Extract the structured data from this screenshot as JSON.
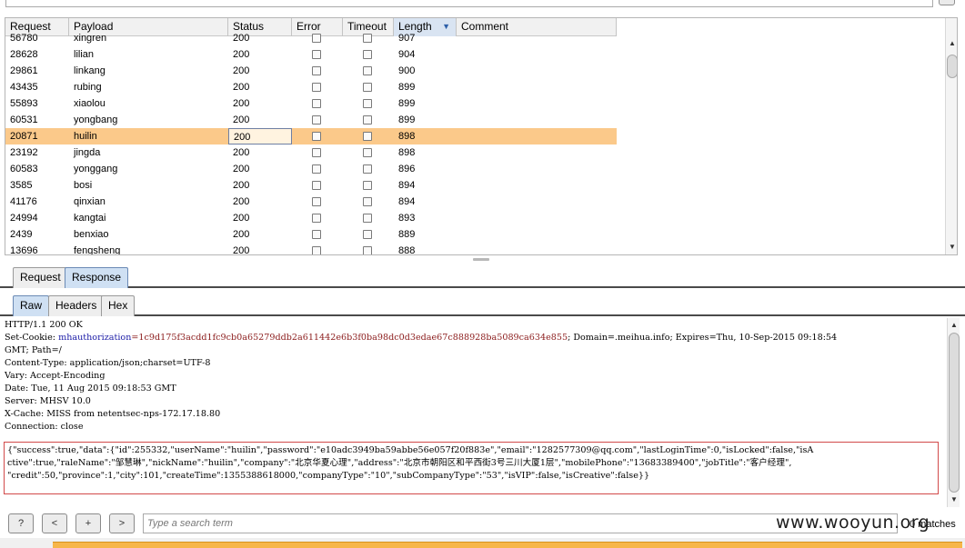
{
  "table": {
    "columns": [
      "Request",
      "Payload",
      "Status",
      "Error",
      "Timeout",
      "Length",
      "Comment"
    ],
    "sorted_column": "Length",
    "rows": [
      {
        "request": "56780",
        "payload": "xingren",
        "status": "200",
        "length": "907"
      },
      {
        "request": "28628",
        "payload": "lilian",
        "status": "200",
        "length": "904"
      },
      {
        "request": "29861",
        "payload": "linkang",
        "status": "200",
        "length": "900"
      },
      {
        "request": "43435",
        "payload": "rubing",
        "status": "200",
        "length": "899"
      },
      {
        "request": "55893",
        "payload": "xiaolou",
        "status": "200",
        "length": "899"
      },
      {
        "request": "60531",
        "payload": "yongbang",
        "status": "200",
        "length": "899"
      },
      {
        "request": "20871",
        "payload": "huilin",
        "status": "200",
        "length": "898",
        "selected": true
      },
      {
        "request": "23192",
        "payload": "jingda",
        "status": "200",
        "length": "898"
      },
      {
        "request": "60583",
        "payload": "yonggang",
        "status": "200",
        "length": "896"
      },
      {
        "request": "3585",
        "payload": "bosi",
        "status": "200",
        "length": "894"
      },
      {
        "request": "41176",
        "payload": "qinxian",
        "status": "200",
        "length": "894"
      },
      {
        "request": "24994",
        "payload": "kangtai",
        "status": "200",
        "length": "893"
      },
      {
        "request": "2439",
        "payload": "benxiao",
        "status": "200",
        "length": "889"
      },
      {
        "request": "13696",
        "payload": "fengsheng",
        "status": "200",
        "length": "888"
      }
    ]
  },
  "message_tabs": [
    {
      "label": "Request",
      "active": false
    },
    {
      "label": "Response",
      "active": true
    }
  ],
  "view_tabs": [
    {
      "label": "Raw",
      "active": true
    },
    {
      "label": "Headers",
      "active": false
    },
    {
      "label": "Hex",
      "active": false
    }
  ],
  "response": {
    "status_line": "HTTP/1.1 200 OK",
    "cookie_header": "Set-Cookie: ",
    "cookie_name": "mhauthorization",
    "cookie_value": "=1c9d175f3acdd1fc9cb0a65279ddb2a611442e6b3f0ba98dc0d3edae67c888928ba5089ca634e855",
    "cookie_rest": "; Domain=.meihua.info; Expires=Thu, 10-Sep-2015 09:18:54",
    "cookie_cont": "GMT; Path=/",
    "headers": [
      "Content-Type: application/json;charset=UTF-8",
      "Vary: Accept-Encoding",
      "Date: Tue, 11 Aug 2015 09:18:53 GMT",
      "Server: MHSV 10.0",
      "X-Cache: MISS from netentsec-nps-172.17.18.80",
      "Connection: close"
    ],
    "json_lines": [
      "{\"success\":true,\"data\":{\"id\":255332,\"userName\":\"huilin\",\"password\":\"e10adc3949ba59abbe56e057f20f883e\",\"email\":\"1282577309@qq.com\",\"lastLoginTime\":0,\"isLocked\":false,\"isA",
      "ctive\":true,\"raleName\":\"邹慧琳\",\"nickName\":\"huilin\",\"company\":\"北京华夏心理\",\"address\":\"北京市朝阳区和平西街3号三川大厦1层\",\"mobilePhone\":\"13683389400\",\"jobTitle\":\"客户经理\",",
      "\"credit\":50,\"province\":1,\"city\":101,\"createTime\":1355388618000,\"companyType\":\"10\",\"subCompanyType\":\"53\",\"isVIP\":false,\"isCreative\":false}}"
    ]
  },
  "bottom_bar": {
    "help_label": "?",
    "prev_label": "<",
    "add_label": "+",
    "next_label": ">",
    "search_placeholder": "Type a search term",
    "matches_label": "0 matches"
  },
  "watermark": "www.wooyun.org",
  "colors": {
    "selected_row": "#fbc98a",
    "active_tab": "#cfe0f3",
    "json_border": "#d24a4a",
    "status_bar": "#f7b64a"
  }
}
